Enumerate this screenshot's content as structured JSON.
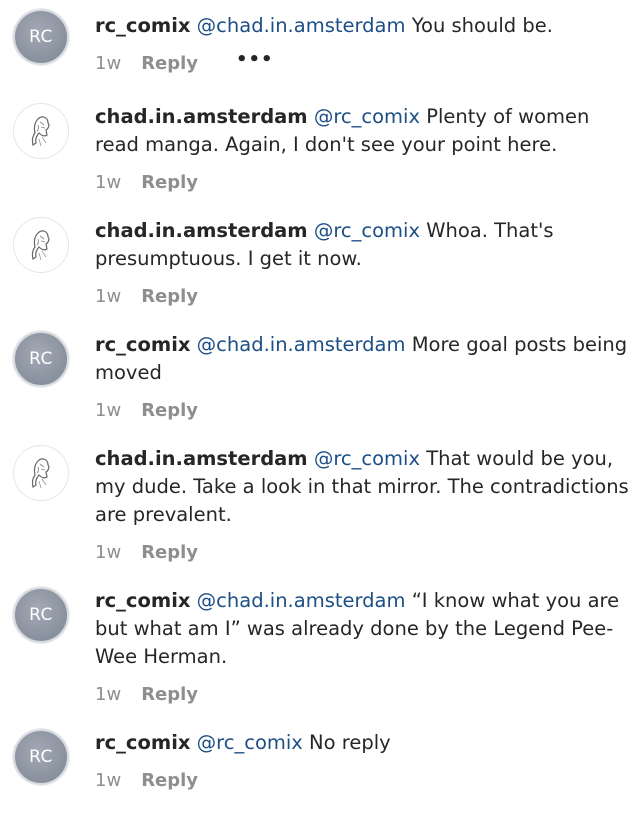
{
  "comments": [
    {
      "avatar": "RC",
      "username": "rc_comix",
      "mention": "@chad.in.amsterdam",
      "text": "You should be.",
      "time": "1w",
      "reply_label": "Reply",
      "more_label": "•••"
    },
    {
      "avatar": "sketch-portrait",
      "username": "chad.in.amsterdam",
      "mention": "@rc_comix",
      "text": "Plenty of women read manga. Again, I don't see your point here.",
      "time": "1w",
      "reply_label": "Reply"
    },
    {
      "avatar": "sketch-portrait",
      "username": "chad.in.amsterdam",
      "mention": "@rc_comix",
      "text": "Whoa. That's presumptuous. I get it now.",
      "time": "1w",
      "reply_label": "Reply"
    },
    {
      "avatar": "RC",
      "username": "rc_comix",
      "mention": "@chad.in.amsterdam",
      "text": "More goal posts being moved",
      "time": "1w",
      "reply_label": "Reply"
    },
    {
      "avatar": "sketch-portrait",
      "username": "chad.in.amsterdam",
      "mention": "@rc_comix",
      "text": "That would be you, my dude. Take a look in that mirror. The contradictions are prevalent.",
      "time": "1w",
      "reply_label": "Reply"
    },
    {
      "avatar": "RC",
      "username": "rc_comix",
      "mention": "@chad.in.amsterdam",
      "text": "“I know what you are but what am I” was already done by the Legend Pee-Wee Herman.",
      "time": "1w",
      "reply_label": "Reply"
    },
    {
      "avatar": "RC",
      "username": "rc_comix",
      "mention": "@rc_comix",
      "text": "No reply",
      "time": "1w",
      "reply_label": "Reply"
    }
  ],
  "colors": {
    "mention": "#1d4e86",
    "meta": "#8e8e8e",
    "text": "#262626",
    "rc_avatar": "#8f96a3"
  }
}
